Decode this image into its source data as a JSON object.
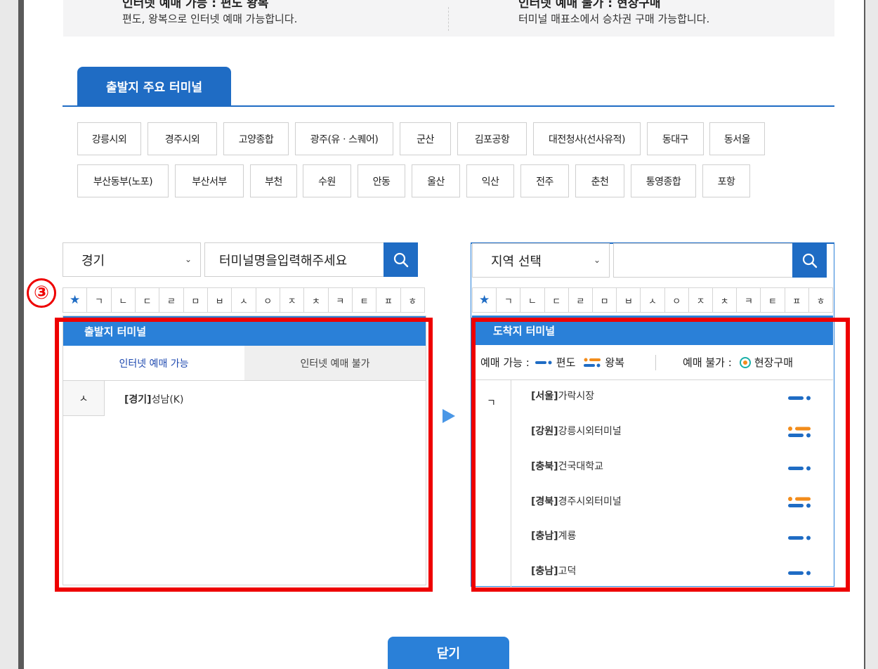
{
  "top_info": {
    "left_title_partial": "인터넷 예매 가능 : 편도 왕복",
    "left_desc": "편도, 왕복으로 인터넷 예매 가능합니다.",
    "right_title_partial": "인터넷 예매 불가 : 현장구매",
    "right_desc": "터미널 매표소에서 승차권 구매 가능합니다."
  },
  "major_tab": {
    "label": "출발지 주요 터미널"
  },
  "major_terminals": [
    "강릉시외",
    "경주시외",
    "고양종합",
    "광주(유ㆍ스퀘어)",
    "군산",
    "김포공항",
    "대전청사(선사유적)",
    "동대구",
    "동서울",
    "부산동부(노포)",
    "부산서부",
    "부천",
    "수원",
    "안동",
    "울산",
    "익산",
    "전주",
    "춘천",
    "통영종합",
    "포항"
  ],
  "departure": {
    "region_select": "경기",
    "search_placeholder": "터미널명을입력해주세요",
    "consonants": [
      "★",
      "ㄱ",
      "ㄴ",
      "ㄷ",
      "ㄹ",
      "ㅁ",
      "ㅂ",
      "ㅅ",
      "ㅇ",
      "ㅈ",
      "ㅊ",
      "ㅋ",
      "ㅌ",
      "ㅍ",
      "ㅎ"
    ],
    "header": "출발지 터미널",
    "tabs": [
      "인터넷 예매 가능",
      "인터넷 예매 불가"
    ],
    "index_letter": "ㅅ",
    "terminals": [
      {
        "region": "[경기]",
        "name": "성남(K)"
      }
    ]
  },
  "arrival": {
    "region_select": "지역 선택",
    "search_value": "",
    "consonants": [
      "★",
      "ㄱ",
      "ㄴ",
      "ㄷ",
      "ㄹ",
      "ㅁ",
      "ㅂ",
      "ㅅ",
      "ㅇ",
      "ㅈ",
      "ㅊ",
      "ㅋ",
      "ㅌ",
      "ㅍ",
      "ㅎ"
    ],
    "header": "도착지 터미널",
    "legend": {
      "available_label": "예매 가능 :",
      "oneway": "편도",
      "roundtrip": "왕복",
      "unavailable_label": "예매 불가 :",
      "onsite": "현장구매"
    },
    "index_letter": "ㄱ",
    "terminals": [
      {
        "region": "[서울]",
        "name": "가락시장",
        "type": "oneway"
      },
      {
        "region": "[강원]",
        "name": "강릉시외터미널",
        "type": "roundtrip"
      },
      {
        "region": "[충북]",
        "name": "건국대학교",
        "type": "oneway"
      },
      {
        "region": "[경북]",
        "name": "경주시외터미널",
        "type": "roundtrip"
      },
      {
        "region": "[충남]",
        "name": "계룡",
        "type": "oneway"
      },
      {
        "region": "[충남]",
        "name": "고덕",
        "type": "oneway"
      }
    ]
  },
  "close_button": "닫기",
  "annotation_marker": "③",
  "colors": {
    "primary": "#1f6cc4",
    "header": "#2a80d8",
    "annotation": "#ee0000",
    "roundtrip_orange": "#f28c1b"
  }
}
